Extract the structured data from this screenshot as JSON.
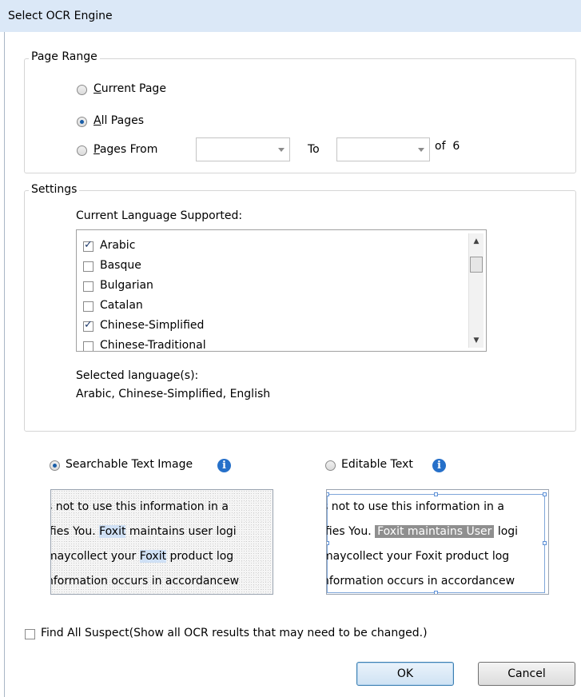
{
  "dialog": {
    "title": "Select OCR Engine"
  },
  "page_range": {
    "legend": "Page Range",
    "current_page": {
      "accel": "C",
      "rest": "urrent Page",
      "selected": false
    },
    "all_pages": {
      "accel": "A",
      "rest": "ll Pages",
      "selected": true
    },
    "pages_from": {
      "accel": "P",
      "rest": "ages From",
      "selected": false
    },
    "from_value": "",
    "to_label": "To",
    "to_value": "",
    "of_label": "of",
    "total_pages": "6"
  },
  "settings": {
    "legend": "Settings",
    "languages_label": "Current Language Supported:",
    "languages": [
      {
        "name": "Arabic",
        "checked": true
      },
      {
        "name": "Basque",
        "checked": false
      },
      {
        "name": "Bulgarian",
        "checked": false
      },
      {
        "name": "Catalan",
        "checked": false
      },
      {
        "name": "Chinese-Simplified",
        "checked": true
      },
      {
        "name": "Chinese-Traditional",
        "checked": false
      }
    ],
    "selected_label": "Selected language(s):",
    "selected_value": "Arabic, Chinese-Simplified, English"
  },
  "output": {
    "searchable": {
      "label": "Searchable Text Image",
      "selected": true
    },
    "editable": {
      "label": "Editable Text",
      "selected": false
    },
    "preview_searchable": {
      "line1": "s not to use this information in a",
      "line2_a": "ifies You. ",
      "line2_hl": "Foxit",
      "line2_b": " maintains user logi",
      "line3_a": "maycollect your ",
      "line3_hl": "Foxit",
      "line3_b": " product log",
      "line4": "nformation occurs in accordancew"
    },
    "preview_editable": {
      "line1": "s not to use this information in a",
      "line2_a": "ifies You. ",
      "line2_hl": "Foxit maintains User",
      "line2_b": " logi",
      "line3": "maycollect your  Foxit product log",
      "line4": "nformation occurs in accordancew"
    }
  },
  "find_all_suspect": {
    "label": "Find All Suspect(Show all OCR results that may need to be changed.)",
    "checked": false
  },
  "buttons": {
    "ok": "OK",
    "cancel": "Cancel"
  }
}
